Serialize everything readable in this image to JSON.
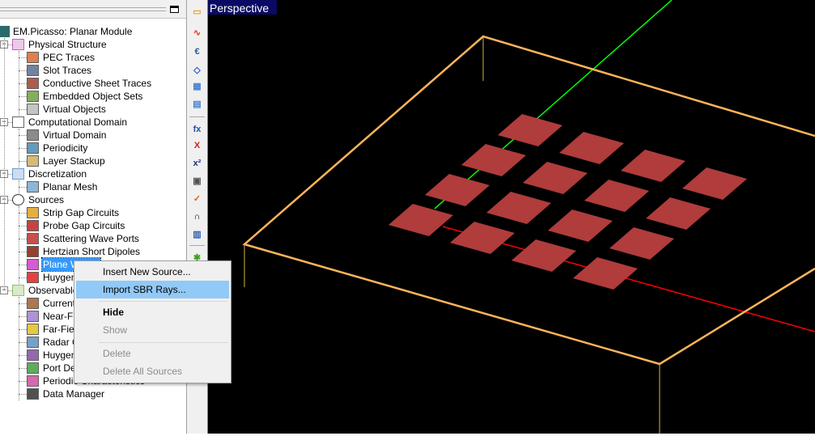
{
  "view": {
    "label": "Perspective",
    "colors": {
      "box": "#ffb45a",
      "patch": "#b03c3c",
      "x_axis": "#ff0000",
      "y_axis": "#00ff00",
      "leg": "#8a7a30"
    }
  },
  "tree": {
    "root": "EM.Picasso: Planar Module",
    "groups": [
      {
        "label": "Physical Structure",
        "icon": "physical-structure-icon",
        "items": [
          "PEC Traces",
          "Slot Traces",
          "Conductive Sheet Traces",
          "Embedded Object Sets",
          "Virtual Objects"
        ]
      },
      {
        "label": "Computational Domain",
        "icon": "domain-box-icon",
        "items": [
          "Virtual Domain",
          "Periodicity",
          "Layer Stackup"
        ]
      },
      {
        "label": "Discretization",
        "icon": "mesh-grid-icon",
        "items": [
          "Planar Mesh"
        ]
      },
      {
        "label": "Sources",
        "icon": "source-sine-icon",
        "items": [
          "Strip Gap Circuits",
          "Probe Gap Circuits",
          "Scattering Wave Ports",
          "Hertzian Short Dipoles",
          "Plane Waves",
          "Huygens Sources"
        ]
      },
      {
        "label": "Observables",
        "icon": "observables-chart-icon",
        "items": [
          "Current Distributions",
          "Near-Field Sensors",
          "Far-Field Radiation Patterns",
          "Radar Cross Sections",
          "Huygens Surfaces",
          "Port Definitions",
          "Periodic Characteristics",
          "Data Manager"
        ]
      }
    ],
    "selected": "Plane Waves"
  },
  "menu": {
    "items": [
      "Insert New Source...",
      "Import SBR Rays...",
      "Hide",
      "Show",
      "Delete",
      "Delete All Sources"
    ]
  },
  "toolbar": {
    "icons": [
      "ruler-icon",
      "wave-icon",
      "cards-icon",
      "box-icon",
      "grid-icon",
      "grid-split-icon",
      "function-icon",
      "excel-icon",
      "superscript-icon",
      "graph-icon",
      "check-icon",
      "chart-icon",
      "calculator-icon",
      "star-icon"
    ]
  }
}
